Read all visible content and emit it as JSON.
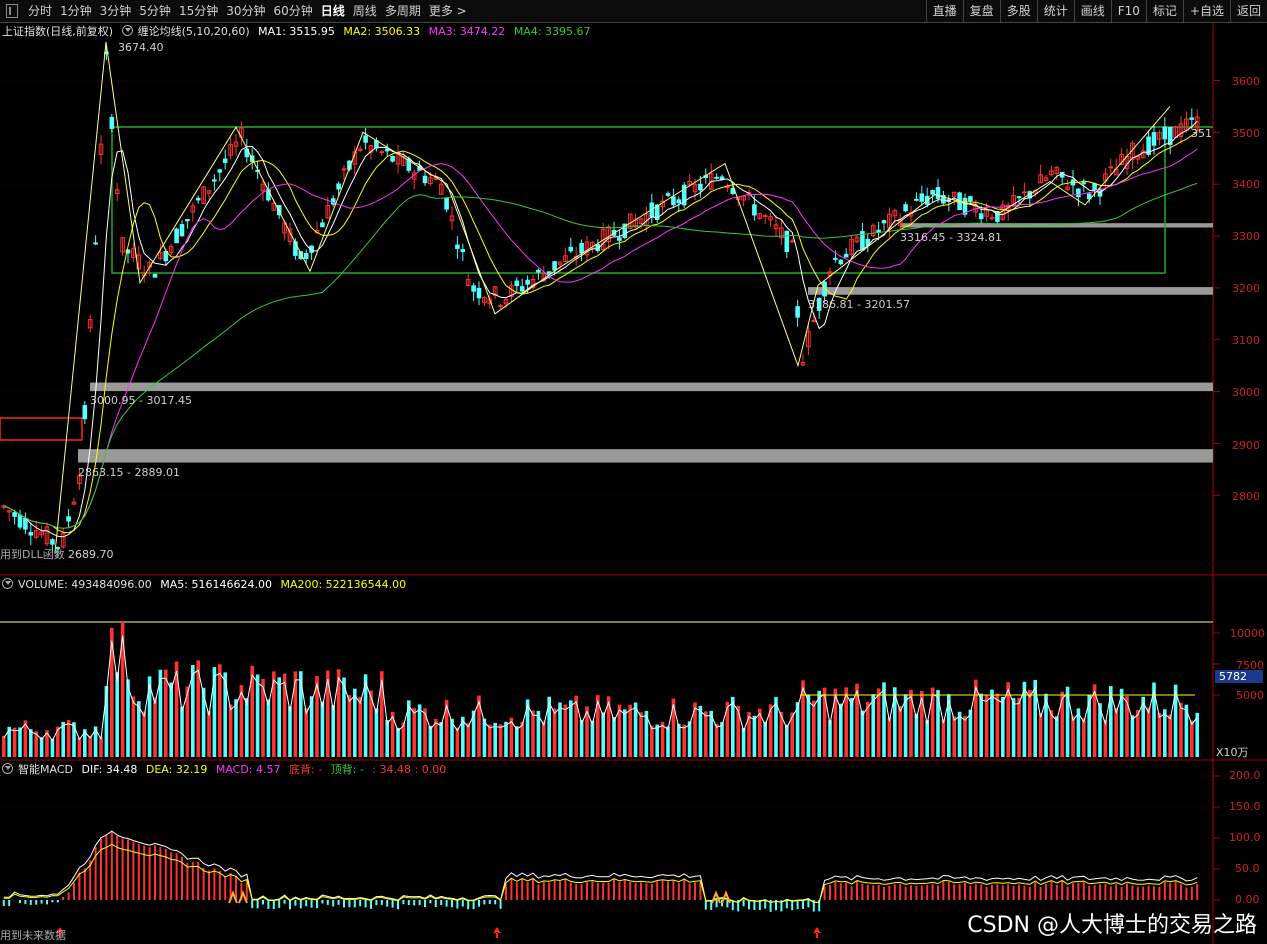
{
  "toolbar": {
    "periods": [
      "分时",
      "1分钟",
      "3分钟",
      "5分钟",
      "15分钟",
      "30分钟",
      "60分钟",
      "日线",
      "周线",
      "多周期",
      "更多 >"
    ],
    "active_period": "日线",
    "right_buttons": [
      "直播",
      "复盘",
      "多股",
      "统计",
      "画线",
      "F10",
      "标记",
      "+自选",
      "返回"
    ]
  },
  "main_panel": {
    "title": "上证指数(日线,前复权)",
    "indicator": "缠论均线(5,10,20,60)",
    "ma1": "MA1: 3515.95",
    "ma2": "MA2: 3506.33",
    "ma3": "MA3: 3474.22",
    "ma4": "MA4: 3395.67",
    "high_label": "3674.40",
    "low_label": "2689.70",
    "bottom_note": "用到DLL函数",
    "last_price_label": "351",
    "zones": [
      "3000.95 - 3017.45",
      "2863.15 - 2889.01",
      "3186.81 - 3201.57",
      "3316.45 - 3324.81"
    ],
    "axis": [
      "3600",
      "3500",
      "3400",
      "3300",
      "3200",
      "3100",
      "3000",
      "2900",
      "2800"
    ]
  },
  "volume_panel": {
    "title": "VOLUME: 493484096.00",
    "ma5": "MA5: 516146624.00",
    "ma200": "MA200: 522136544.00",
    "axis": [
      "10000",
      "7500",
      "5000"
    ],
    "current_tag": "5782",
    "unit": "X10万"
  },
  "macd_panel": {
    "title": "智能MACD",
    "dif": "DIF: 34.48",
    "dea": "DEA: 32.19",
    "macd": "MACD: 4.57",
    "bottom_div": "底背: -",
    "top_div": "顶背: -",
    "extra": ": 34.48 : 0.00",
    "axis": [
      "200.0",
      "150.0",
      "100.0",
      "50.0",
      "0.00"
    ],
    "bottom_note": "用到未来数据"
  },
  "watermark": "CSDN @人大博士的交易之路",
  "colors": {
    "up": "#ff3232",
    "down": "#54ffff",
    "ma1": "#ffffff",
    "ma2": "#ffff00",
    "ma3": "#ff33ff",
    "ma4": "#33cc33",
    "grid": "#880000"
  }
}
